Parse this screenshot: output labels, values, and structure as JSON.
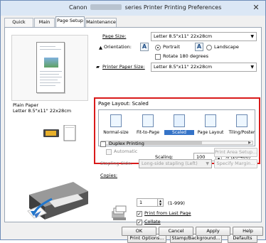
{
  "window": {
    "title_prefix": "Canon",
    "title_suffix": "series Printer Printing Preferences",
    "close_symbol": "✕"
  },
  "tabs": [
    {
      "label": "Quick Setup"
    },
    {
      "label": "Main"
    },
    {
      "label": "Page Setup"
    },
    {
      "label": "Maintenance"
    }
  ],
  "preview": {
    "paper_label_line1": "Plain Paper",
    "paper_label_line2": "Letter 8.5\"x11\" 22x28cm"
  },
  "page_setup": {
    "page_size_label": "Page Size:",
    "page_size_value": "Letter 8.5\"x11\" 22x28cm",
    "orientation_label": "Orientation:",
    "portrait_label": "Portrait",
    "landscape_label": "Landscape",
    "rotate_label": "Rotate 180 degrees",
    "printer_paper_size_label": "Printer Paper Size:",
    "printer_paper_size_value": "Letter 8.5\"x11\" 22x28cm",
    "page_layout_label": "Page Layout:",
    "page_layout_value": "Scaled",
    "layout_options": [
      {
        "label": "Normal-size"
      },
      {
        "label": "Fit-to-Page"
      },
      {
        "label": "Scaled"
      },
      {
        "label": "Page Layout"
      },
      {
        "label": "Tiling/Poster"
      }
    ],
    "scaling_label": "Scaling:",
    "scaling_value": "100",
    "scaling_range": "% (20-400)",
    "duplex_label": "Duplex Printing",
    "automatic_label": "Automatic",
    "print_area_setup_label": "Print Area Setup...",
    "stapling_side_label": "Stapling Side:",
    "stapling_side_value": "Long-side stapling (Left)",
    "specify_margin_label": "Specify Margin...",
    "copies_label": "Copies:",
    "copies_value": "1",
    "copies_range": "(1-999)",
    "print_from_last_label": "Print from Last Page",
    "collate_label": "Collate",
    "print_options_label": "Print Options...",
    "stamp_background_label": "Stamp/Background...",
    "defaults_label": "Defaults"
  },
  "footer": {
    "ok_label": "OK",
    "cancel_label": "Cancel",
    "apply_label": "Apply",
    "help_label": "Help"
  },
  "colors": {
    "highlight_red": "#d91a1a",
    "selected_blue": "#3573c7"
  },
  "icons": {
    "close": "close-icon",
    "portrait": "portrait-orientation-icon",
    "landscape": "landscape-orientation-icon",
    "printer": "printer-icon",
    "copies": "copies-icon"
  }
}
